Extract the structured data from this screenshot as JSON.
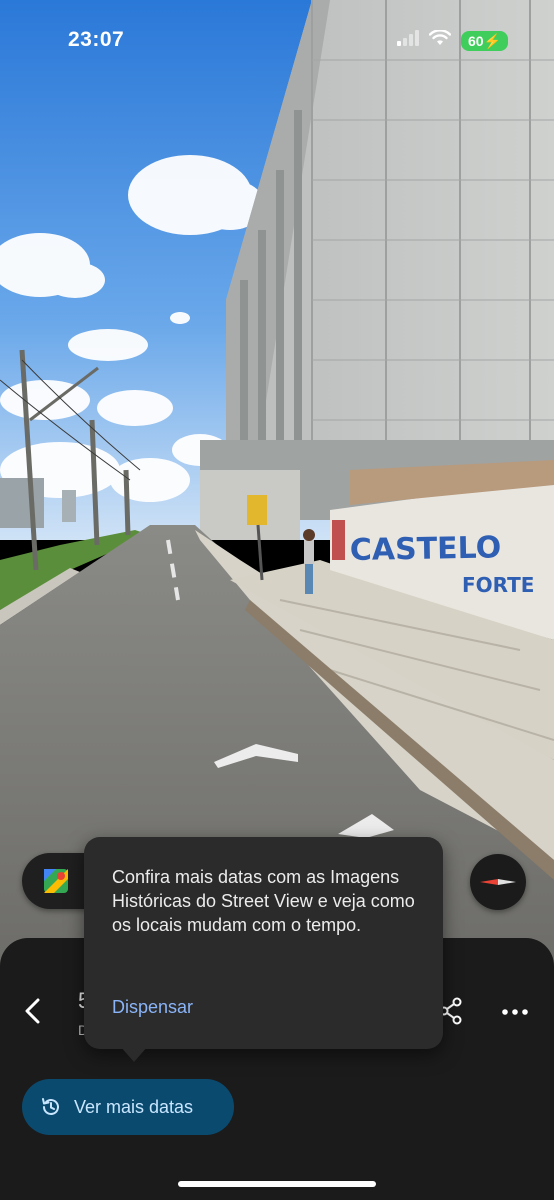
{
  "status_bar": {
    "time": "23:07",
    "battery": "60"
  },
  "tooltip": {
    "message": "Confira mais datas com as Imagens Históricas do Street View e veja como os locais mudam com o tempo.",
    "dismiss_label": "Dispensar"
  },
  "sheet": {
    "address_initial": "5",
    "address_sub_initial": "D",
    "see_more_dates_label": "Ver mais datas"
  },
  "scene": {
    "wall_sign_top": "CASTELO",
    "wall_sign_bottom": "FORTE"
  },
  "icons": {
    "maps": "google-maps-icon",
    "compass": "compass-icon",
    "back": "back-chevron-icon",
    "share": "share-icon",
    "more": "more-horizontal-icon",
    "history": "history-icon"
  },
  "colors": {
    "sheet_bg": "#1b1b1b",
    "tooltip_bg": "#2b2b2b",
    "link": "#8ab4f8",
    "dates_button_bg": "#0b4a6f",
    "battery_green": "#3fce5b"
  }
}
